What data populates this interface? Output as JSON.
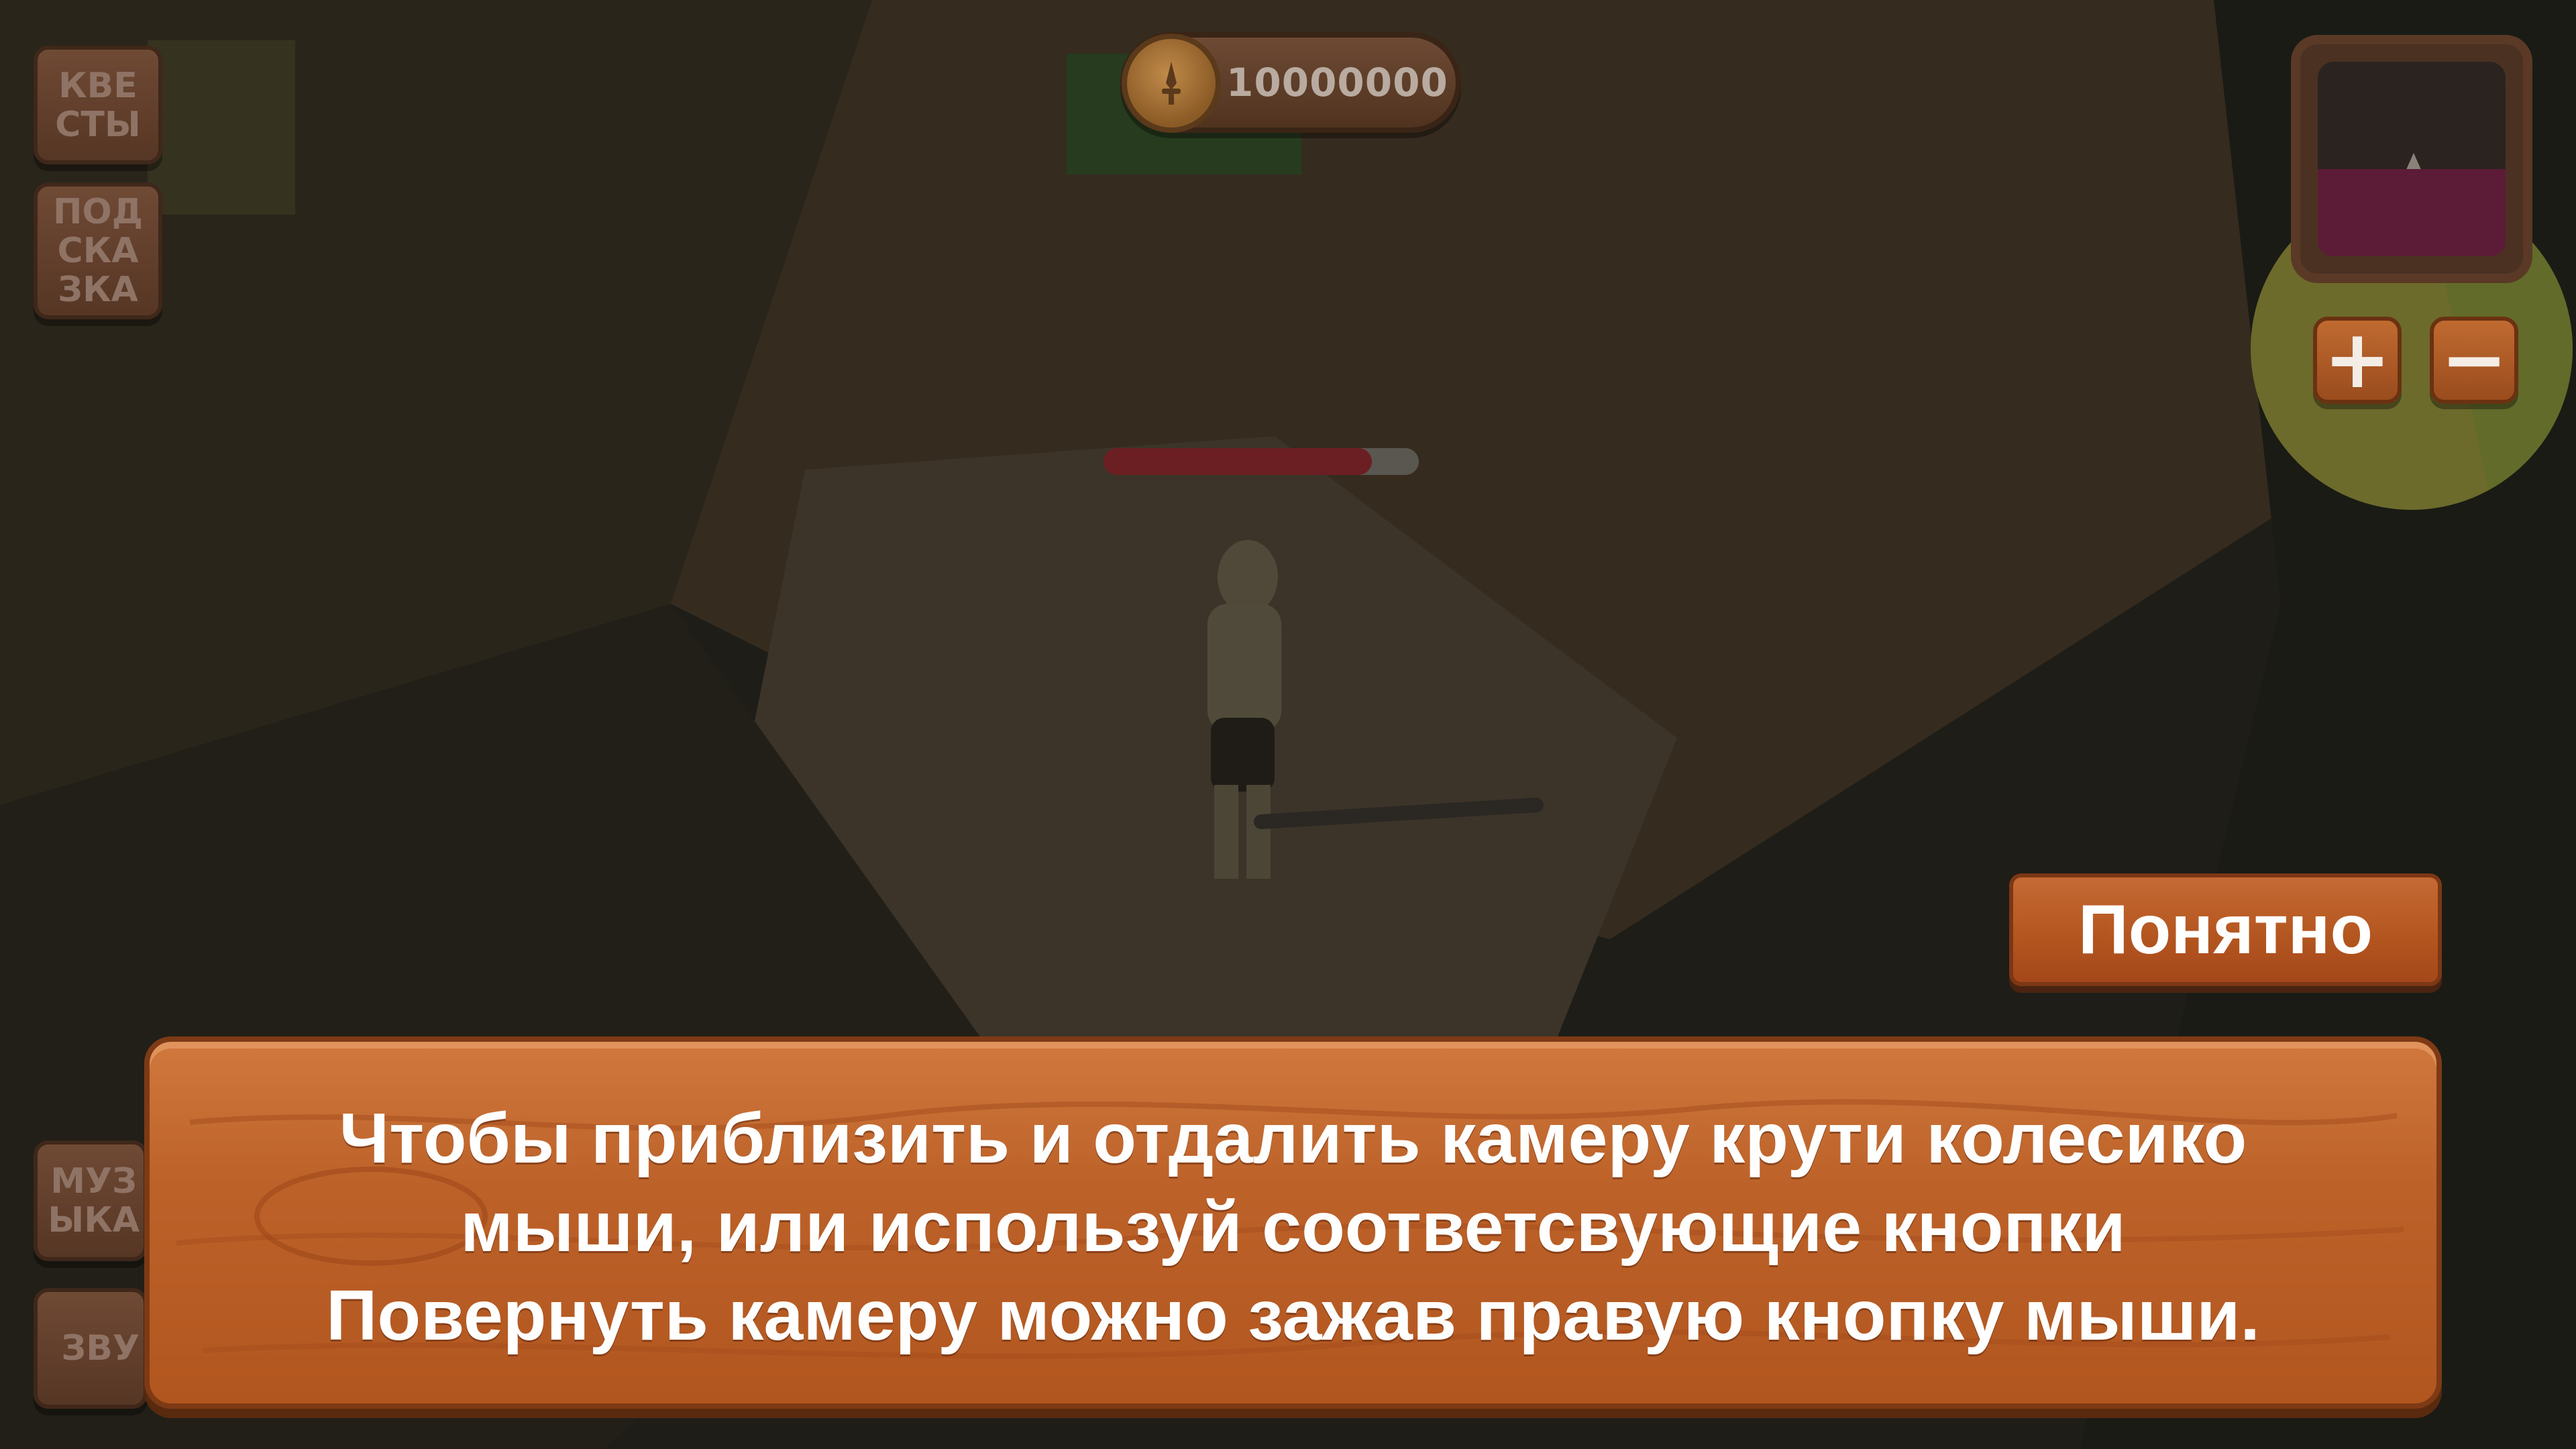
{
  "hud": {
    "coins": "10000000",
    "buttons": {
      "quests": "КВЕ\nСТЫ",
      "hint": "ПОД\nСКА\nЗКА",
      "music": "МУЗ\nЫКА",
      "sound": "ЗВУ"
    },
    "zoom_in": "+",
    "zoom_out": "−"
  },
  "player": {
    "health_fraction": 0.85
  },
  "tutorial": {
    "message": "Чтобы приблизить и отдалить камеру крути колесико\nмыши, или используй соответсвующие кнопки\nПовернуть камеру можно зажав правую кнопку мыши.",
    "confirm_label": "Понятно"
  },
  "colors": {
    "wood": "#b85b25",
    "button_text": "#ffffff",
    "health": "#6b1f22"
  },
  "icons": {
    "coin": "sword-coin-icon",
    "minimap_player": "arrow-up-icon"
  }
}
